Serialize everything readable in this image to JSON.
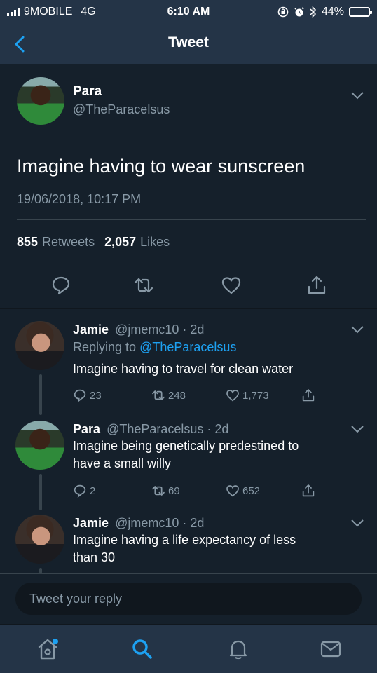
{
  "status_bar": {
    "carrier": "9MOBILE",
    "network": "4G",
    "time": "6:10 AM",
    "battery_percent": "44%",
    "battery_level": 0.44,
    "battery_color": "#f5c518"
  },
  "header": {
    "title": "Tweet",
    "back_icon": "chevron-left-icon"
  },
  "main_tweet": {
    "name": "Para",
    "handle": "@TheParacelsus",
    "text": "Imagine having to wear sunscreen",
    "timestamp": "19/06/2018, 10:17 PM",
    "retweets_count": "855",
    "retweets_label": "Retweets",
    "likes_count": "2,057",
    "likes_label": "Likes",
    "actions": [
      "reply-icon",
      "retweet-icon",
      "like-icon",
      "share-icon"
    ]
  },
  "replies": [
    {
      "name": "Jamie",
      "handle": "@jmemc10",
      "time": "· 2d",
      "replying_label": "Replying to",
      "replying_to": "@TheParacelsus",
      "line1": "Imagine having to travel for clean water",
      "line2": "",
      "reply_count": "23",
      "retweet_count": "248",
      "like_count": "1,773"
    },
    {
      "name": "Para",
      "handle": "@TheParacelsus",
      "time": "· 2d",
      "line1": "Imagine being genetically predestined to",
      "line2": "have a small willy",
      "reply_count": "2",
      "retweet_count": "69",
      "like_count": "652"
    },
    {
      "name": "Jamie",
      "handle": "@jmemc10",
      "time": "· 2d",
      "line1": "Imagine having a life expectancy of less",
      "line2": "than 30"
    }
  ],
  "composer": {
    "placeholder": "Tweet your reply"
  },
  "tab_bar": {
    "tabs": [
      "home-icon",
      "search-icon",
      "notifications-icon",
      "messages-icon"
    ],
    "active_color": "#1da1f2"
  },
  "colors": {
    "background": "#15202b",
    "bar_background": "#243447",
    "secondary_text": "#8899a6",
    "link": "#1da1f2"
  }
}
